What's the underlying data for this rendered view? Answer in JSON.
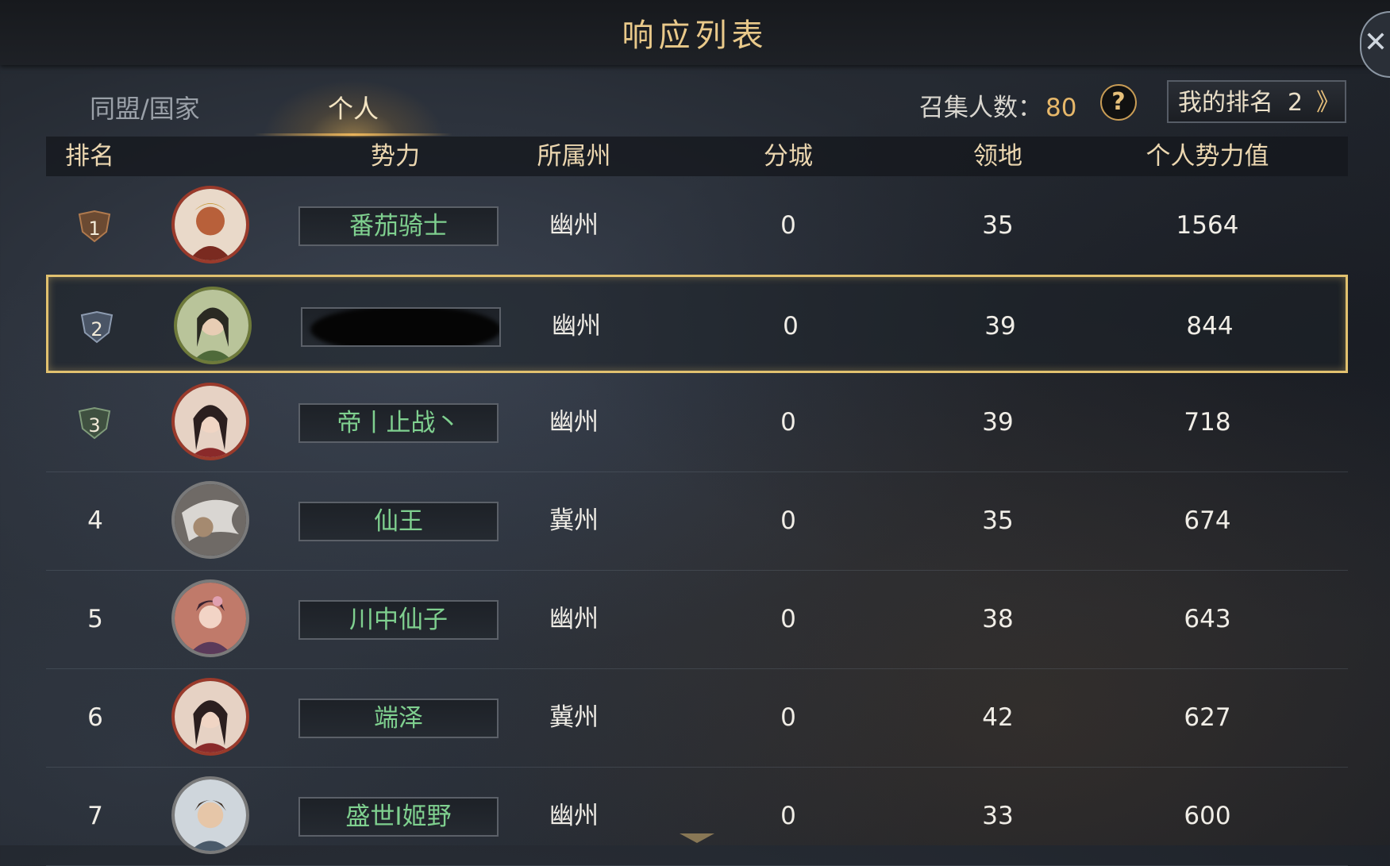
{
  "header": {
    "title": "响应列表"
  },
  "tabs": [
    {
      "label": "同盟/国家",
      "active": false
    },
    {
      "label": "个人",
      "active": true
    }
  ],
  "gather": {
    "label": "召集人数：",
    "value": "80"
  },
  "help": {
    "label": "?"
  },
  "my_rank": {
    "label": "我的排名",
    "value": "2",
    "arrow": "》"
  },
  "columns": [
    "排名",
    "势力",
    "所属州",
    "分城",
    "领地",
    "个人势力值"
  ],
  "rows": [
    {
      "rank": "1",
      "name": "番茄骑士",
      "state": "幽州",
      "branch": "0",
      "land": "35",
      "power": "1564"
    },
    {
      "rank": "2",
      "name": "",
      "state": "幽州",
      "branch": "0",
      "land": "39",
      "power": "844"
    },
    {
      "rank": "3",
      "name": "帝丨止战丶",
      "state": "幽州",
      "branch": "0",
      "land": "39",
      "power": "718"
    },
    {
      "rank": "4",
      "name": "仙王",
      "state": "冀州",
      "branch": "0",
      "land": "35",
      "power": "674"
    },
    {
      "rank": "5",
      "name": "川中仙子",
      "state": "幽州",
      "branch": "0",
      "land": "38",
      "power": "643"
    },
    {
      "rank": "6",
      "name": "端泽",
      "state": "冀州",
      "branch": "0",
      "land": "42",
      "power": "627"
    },
    {
      "rank": "7",
      "name": "盛世I姬野",
      "state": "幽州",
      "branch": "0",
      "land": "33",
      "power": "600"
    }
  ],
  "colors": {
    "accent": "#e1c16f",
    "name_text": "#7fd08f",
    "title": "#e9c98a"
  }
}
